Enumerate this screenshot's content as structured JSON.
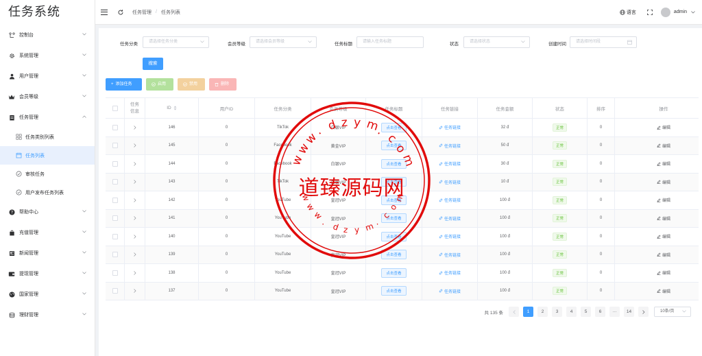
{
  "app": {
    "title": "任务系统"
  },
  "sidebar": {
    "items": [
      {
        "label": "控制台",
        "icon": "dashboard-icon",
        "arrow": "down"
      },
      {
        "label": "系统管理",
        "icon": "gear-icon",
        "arrow": "down"
      },
      {
        "label": "用户管理",
        "icon": "user-icon",
        "arrow": "down"
      },
      {
        "label": "会员等级",
        "icon": "crown-icon",
        "arrow": "down"
      },
      {
        "label": "任务管理",
        "icon": "clipboard-icon",
        "arrow": "up"
      }
    ],
    "submenu": [
      {
        "label": "任务类别列表",
        "icon": "grid-icon",
        "active": false
      },
      {
        "label": "任务列表",
        "icon": "calendar-icon",
        "active": true
      },
      {
        "label": "审核任务",
        "icon": "check-circle-icon",
        "active": false
      },
      {
        "label": "用户发布任务列表",
        "icon": "check-circle-icon",
        "active": false
      }
    ],
    "items2": [
      {
        "label": "帮助中心",
        "icon": "question-icon"
      },
      {
        "label": "充值管理",
        "icon": "bag-icon"
      },
      {
        "label": "新闻管理",
        "icon": "news-icon"
      },
      {
        "label": "提现管理",
        "icon": "wallet-icon"
      },
      {
        "label": "国家管理",
        "icon": "globe-icon"
      },
      {
        "label": "理财管理",
        "icon": "coins-icon"
      }
    ]
  },
  "header": {
    "breadcrumb": [
      "任务管理",
      "任务列表"
    ],
    "language_label": "语言",
    "username": "admin"
  },
  "filters": {
    "category_label": "任务分类",
    "category_placeholder": "请选择任务分类",
    "level_label": "会员等级",
    "level_placeholder": "请选择会员等级",
    "title_label": "任务标题",
    "title_placeholder": "请输入任务标题",
    "status_label": "状态",
    "status_placeholder": "请选择状态",
    "time_label": "创建时间",
    "time_placeholder": "请选择时间段",
    "search_label": "搜索"
  },
  "toolbar": {
    "add_label": "添加任务",
    "enable_label": "启用",
    "disable_label": "禁用",
    "delete_label": "删除"
  },
  "table": {
    "headers": {
      "info": "任务信息",
      "id": "ID",
      "user_id": "用户ID",
      "category": "任务分类",
      "level": "会员等级",
      "title": "任务标题",
      "link": "任务链接",
      "amount": "任务金额",
      "status": "状态",
      "sort": "排序",
      "ops": "操作"
    },
    "view_label": "点击查看",
    "link_label": "任务链接",
    "edit_label": "编辑",
    "rows": [
      {
        "id": "146",
        "user_id": "0",
        "category": "TikTok",
        "level": "白银VIP",
        "amount": "32 đ",
        "status": "正常",
        "sort": "0"
      },
      {
        "id": "145",
        "user_id": "0",
        "category": "Facebook",
        "level": "黄金VIP",
        "amount": "50 đ",
        "status": "正常",
        "sort": "0"
      },
      {
        "id": "144",
        "user_id": "0",
        "category": "Facebook",
        "level": "白银VIP",
        "amount": "30 đ",
        "status": "正常",
        "sort": "0"
      },
      {
        "id": "143",
        "user_id": "0",
        "category": "TikTok",
        "level": "白银VIP",
        "amount": "10 đ",
        "status": "正常",
        "sort": "0"
      },
      {
        "id": "142",
        "user_id": "0",
        "category": "YouTube",
        "level": "皇冠VIP",
        "amount": "100 đ",
        "status": "正常",
        "sort": "0"
      },
      {
        "id": "141",
        "user_id": "0",
        "category": "YouTube",
        "level": "皇冠VIP",
        "amount": "100 đ",
        "status": "正常",
        "sort": "0"
      },
      {
        "id": "140",
        "user_id": "0",
        "category": "YouTube",
        "level": "皇冠VIP",
        "amount": "100 đ",
        "status": "正常",
        "sort": "0"
      },
      {
        "id": "139",
        "user_id": "0",
        "category": "YouTube",
        "level": "皇冠VIP",
        "amount": "100 đ",
        "status": "正常",
        "sort": "0"
      },
      {
        "id": "138",
        "user_id": "0",
        "category": "YouTube",
        "level": "皇冠VIP",
        "amount": "100 đ",
        "status": "正常",
        "sort": "0"
      },
      {
        "id": "137",
        "user_id": "0",
        "category": "YouTube",
        "level": "皇冠VIP",
        "amount": "100 đ",
        "status": "正常",
        "sort": "0"
      }
    ]
  },
  "pagination": {
    "total": "共 135 条",
    "pages": [
      "1",
      "2",
      "3",
      "4",
      "5",
      "6",
      "···",
      "14"
    ],
    "current": "1",
    "page_size": "10条/页"
  },
  "watermark": {
    "text": "道臻源码网",
    "letters_top": "www.dzym.com",
    "letters_bottom": "www.dzym.com"
  },
  "colors": {
    "primary": "#409eff",
    "success": "#67c23a",
    "watermark": "#e10b0b"
  }
}
